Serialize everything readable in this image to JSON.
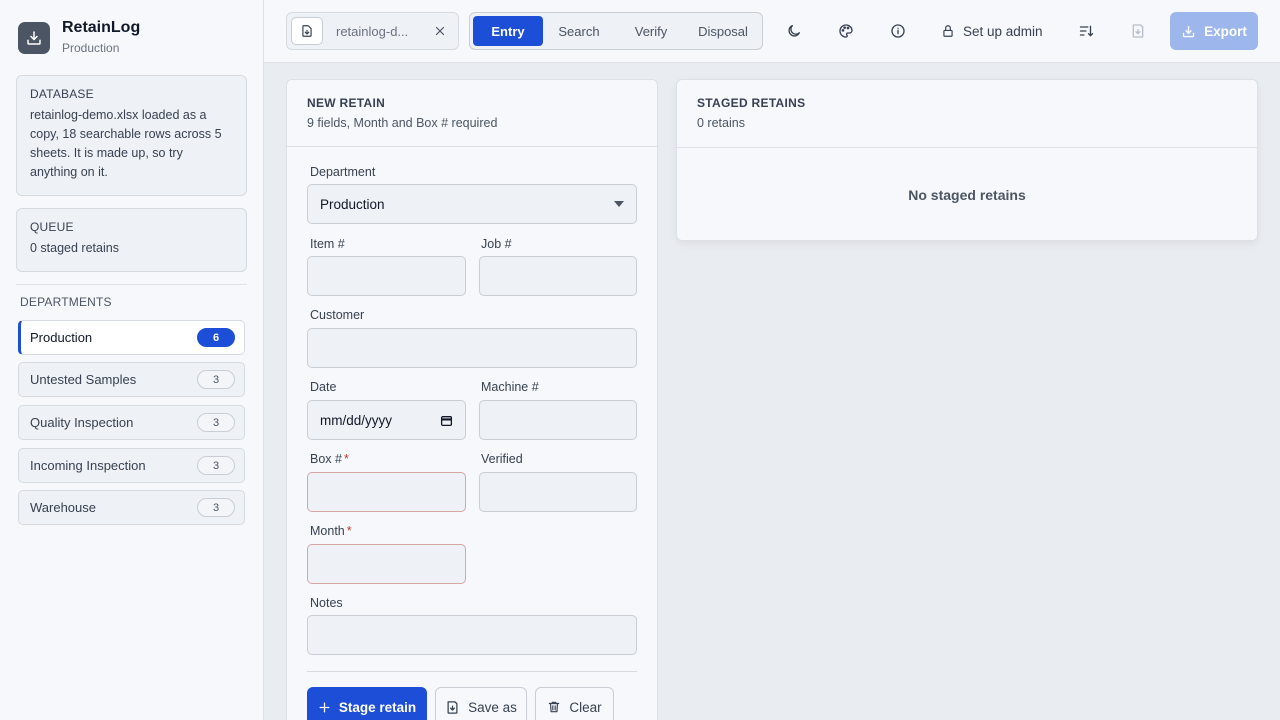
{
  "app": {
    "title": "RetainLog",
    "subtitle": "Production"
  },
  "sidebar": {
    "database": {
      "label": "DATABASE",
      "text": "retainlog-demo.xlsx loaded as a copy, 18 searchable rows across 5 sheets. It is made up, so try anything on it."
    },
    "queue": {
      "label": "QUEUE",
      "text": "0 staged retains"
    },
    "departments_label": "DEPARTMENTS",
    "departments": [
      {
        "name": "Production",
        "count": "6",
        "active": true
      },
      {
        "name": "Untested Samples",
        "count": "3"
      },
      {
        "name": "Quality Inspection",
        "count": "3"
      },
      {
        "name": "Incoming Inspection",
        "count": "3"
      },
      {
        "name": "Warehouse",
        "count": "3"
      }
    ]
  },
  "topbar": {
    "file_name": "retainlog-d...",
    "tabs": [
      "Entry",
      "Search",
      "Verify",
      "Disposal"
    ],
    "active_tab": "Entry",
    "admin_label": "Set up admin",
    "export_label": "Export",
    "icons": [
      "moon-icon",
      "palette-icon",
      "info-icon",
      "lock-icon",
      "sort-icon",
      "save-icon",
      "download-icon"
    ]
  },
  "form": {
    "title": "NEW RETAIN",
    "subtitle": "9 fields, Month and Box # required",
    "department_label": "Department",
    "department_value": "Production",
    "item_label": "Item #",
    "job_label": "Job #",
    "customer_label": "Customer",
    "date_label": "Date",
    "date_placeholder": "mm/dd/yyyy",
    "machine_label": "Machine #",
    "box_label": "Box #",
    "verified_label": "Verified",
    "month_label": "Month",
    "notes_label": "Notes",
    "required_mark": "*",
    "stage_label": "Stage retain",
    "save_as_label": "Save as",
    "clear_label": "Clear"
  },
  "staged": {
    "title": "STAGED RETAINS",
    "count_text": "0 retains",
    "empty_text": "No staged retains"
  },
  "colors": {
    "accent": "#1d4ed8",
    "export_disabled": "#9db6ec",
    "required": "#c0392b"
  }
}
